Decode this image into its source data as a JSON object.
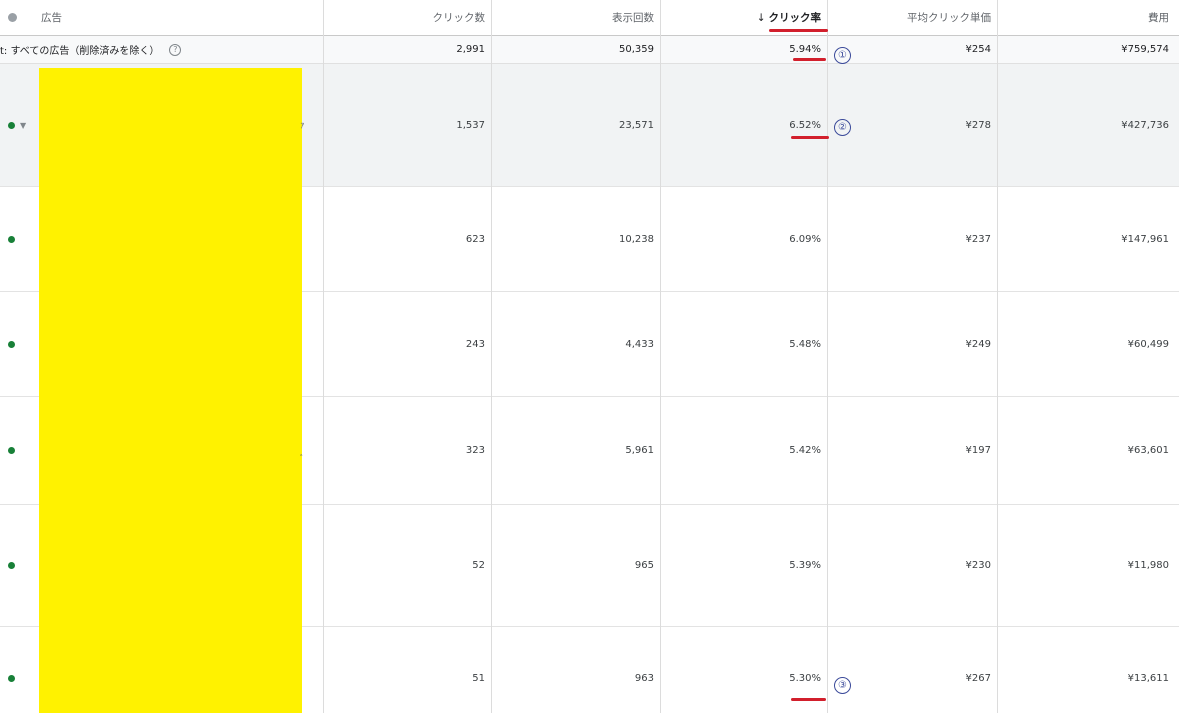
{
  "header": {
    "ad_col": "広告",
    "clicks": "クリック数",
    "impressions": "表示回数",
    "sort_arrow": "↓",
    "ctr": "クリック率",
    "avg_cpc": "平均クリック単価",
    "cost": "費用"
  },
  "total": {
    "label": "t: すべての広告（削除済みを除く）",
    "help_icon": "?",
    "clicks": "2,991",
    "impressions": "50,359",
    "ctr": "5.94%",
    "avg_cpc": "¥254",
    "cost": "¥759,574"
  },
  "rows": [
    {
      "clicks": "1,537",
      "impressions": "23,571",
      "ctr": "6.52%",
      "avg_cpc": "¥278",
      "cost": "¥427,736"
    },
    {
      "clicks": "623",
      "impressions": "10,238",
      "ctr": "6.09%",
      "avg_cpc": "¥237",
      "cost": "¥147,961"
    },
    {
      "clicks": "243",
      "impressions": "4,433",
      "ctr": "5.48%",
      "avg_cpc": "¥249",
      "cost": "¥60,499"
    },
    {
      "clicks": "323",
      "impressions": "5,961",
      "ctr": "5.42%",
      "avg_cpc": "¥197",
      "cost": "¥63,601"
    },
    {
      "clicks": "52",
      "impressions": "965",
      "ctr": "5.39%",
      "avg_cpc": "¥230",
      "cost": "¥11,980"
    },
    {
      "clicks": "51",
      "impressions": "963",
      "ctr": "5.30%",
      "avg_cpc": "¥267",
      "cost": "¥13,611"
    }
  ],
  "annotations": {
    "marker_1": "①",
    "marker_2": "②",
    "marker_3": "③"
  },
  "colors": {
    "status_active": "#188038",
    "underline_red": "#d21f2c",
    "redaction_yellow": "#fff200",
    "annotation_blue": "#3b4a9a"
  }
}
